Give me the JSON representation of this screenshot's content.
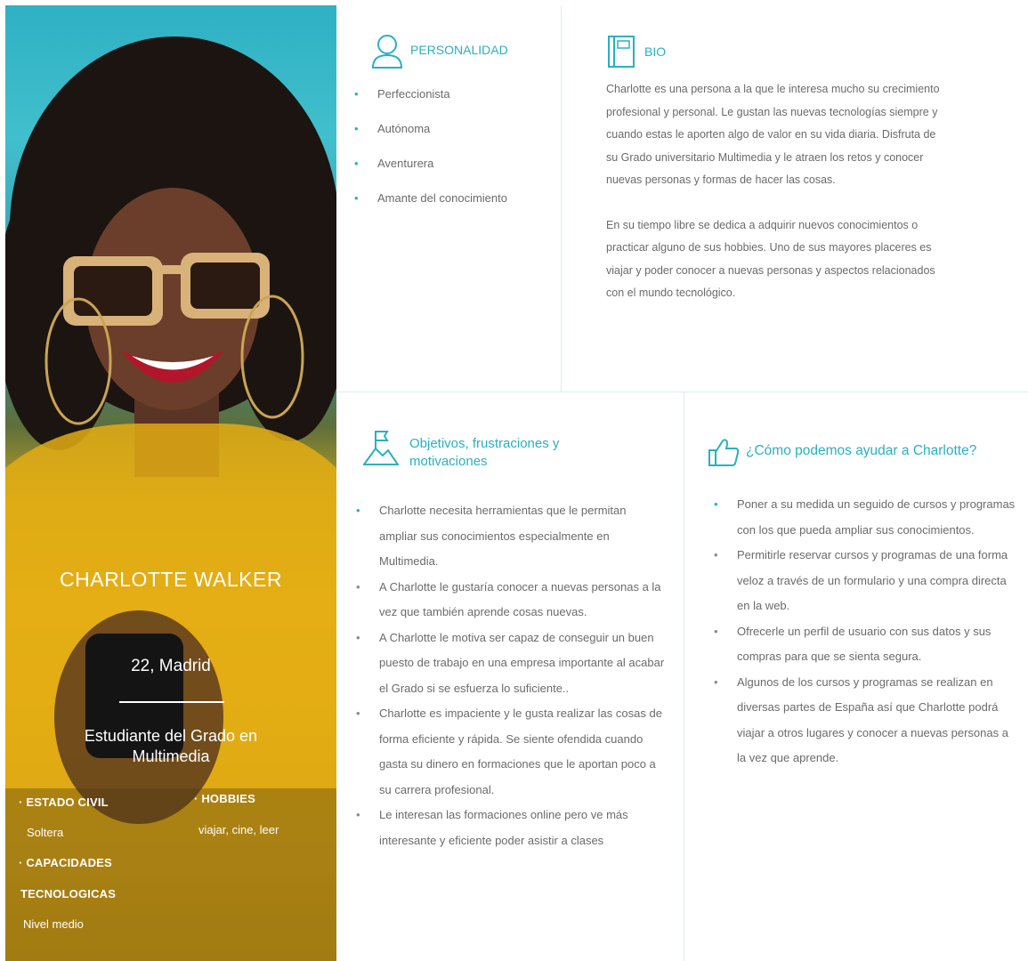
{
  "profile": {
    "name": "CHARLOTTE WALKER",
    "age_city": "22, Madrid",
    "study": "Estudiante del Grado en Multimedia",
    "marital_label": "· ESTADO  CIVIL",
    "marital_value": "Soltera",
    "hobbies_label": "· HOBBIES",
    "hobbies_value": "viajar, cine, leer",
    "tech_label_1": "· CAPACIDADES",
    "tech_label_2": "TECNOLOGICAS",
    "tech_value": "Nivel medio"
  },
  "personality": {
    "title": "PERSONALIDAD",
    "items": [
      "Perfeccionista",
      "Autónoma",
      "Aventurera",
      "Amante del conocimiento"
    ]
  },
  "bio": {
    "title": "BIO",
    "paragraph_1": "Charlotte es una persona a la que le interesa mucho su crecimiento profesional y personal. Le gustan las nuevas tecnologías siempre y cuando estas le aporten algo de valor en su vida diaria.  Disfruta de su Grado universitario Multimedia y le atraen los retos y conocer nuevas personas y formas de hacer las cosas.",
    "paragraph_2": "En su tiempo libre se dedica a adquirir nuevos conocimientos o practicar alguno de sus hobbies. Uno de sus mayores placeres es viajar y poder conocer a nuevas personas y aspectos relacionados con el mundo tecnológico."
  },
  "goals": {
    "title": "Objetivos, frustraciones y motivaciones",
    "items": [
      "Charlotte necesita herramientas que le permitan ampliar sus conocimientos especialmente en Multimedia.",
      "A Charlotte le gustaría conocer a nuevas personas a la vez que también aprende cosas nuevas.",
      "A Charlotte le motiva ser capaz de conseguir un buen puesto de trabajo  en una empresa importante al acabar el Grado si se esfuerza lo suficiente..",
      "Charlotte es impaciente y le gusta realizar las cosas de forma eficiente y rápida. Se siente ofendida cuando gasta su dinero en formaciones que le aportan poco a su carrera profesional.",
      "Le interesan las formaciones online pero ve más interesante y eficiente poder  asistir a clases"
    ]
  },
  "help": {
    "title": "¿Cómo podemos ayudar a Charlotte?",
    "items": [
      "Poner a su medida un seguido de cursos y programas con los que pueda ampliar sus conocimientos.",
      "Permitirle reservar cursos y programas de una forma veloz a través de un formulario y una compra directa en la web.",
      "Ofrecerle un perfil de usuario con sus datos y sus compras para que se sienta segura.",
      "Algunos de los cursos y programas se realizan en diversas partes de España así que Charlotte podrá viajar a otros lugares y conocer a nuevas personas a la vez que aprende."
    ]
  },
  "colors": {
    "accent": "#2ab0c0",
    "body_text": "#6b6b6b",
    "divider": "#dbeef1",
    "sky": "#3ec0cf",
    "sweater": "#e8b415"
  }
}
